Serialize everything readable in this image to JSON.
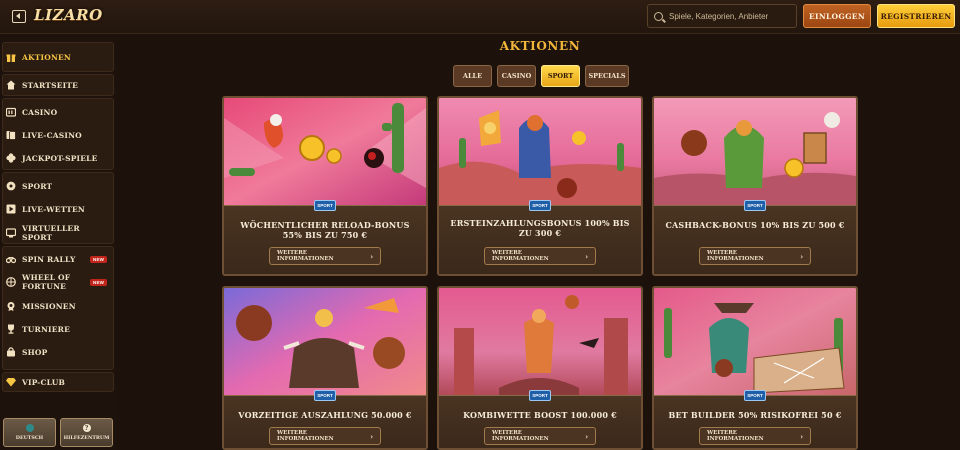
{
  "header": {
    "logo": "LIZARO",
    "search_placeholder": "Spiele, Kategorien, Anbieter",
    "login_label": "EINLOGGEN",
    "register_label": "REGISTRIEREN"
  },
  "sidebar": {
    "items": [
      {
        "label": "AKTIONEN",
        "icon": "gift-icon"
      },
      {
        "label": "STARTSEITE",
        "icon": "home-icon"
      },
      {
        "label": "CASINO",
        "icon": "slot-icon"
      },
      {
        "label": "LIVE-CASINO",
        "icon": "cards-icon"
      },
      {
        "label": "JACKPOT-SPIELE",
        "icon": "clover-icon"
      },
      {
        "label": "SPORT",
        "icon": "ball-icon"
      },
      {
        "label": "LIVE-WETTEN",
        "icon": "play-icon"
      },
      {
        "label": "VIRTUELLER SPORT",
        "icon": "virtual-icon"
      },
      {
        "label": "SPIN RALLY",
        "icon": "rally-icon",
        "badge": "NEW"
      },
      {
        "label": "WHEEL OF FORTUNE",
        "icon": "wheel-icon",
        "badge": "NEW"
      },
      {
        "label": "MISSIONEN",
        "icon": "medal-icon"
      },
      {
        "label": "TURNIERE",
        "icon": "trophy-icon"
      },
      {
        "label": "SHOP",
        "icon": "bag-icon"
      },
      {
        "label": "VIP-CLUB",
        "icon": "diamond-icon"
      }
    ],
    "language_label": "DEUTSCH",
    "help_label": "HILFEZENTRUM"
  },
  "main": {
    "title": "AKTIONEN",
    "filters": [
      "ALLE",
      "CASINO",
      "SPORT",
      "SPECIALS"
    ],
    "active_filter": "SPORT",
    "tag": "SPORT",
    "more_label": "WEITERE INFORMATIONEN",
    "cards": [
      {
        "title": "WÖCHENTLICHER RELOAD-BONUS 55% BIS ZU 750 €"
      },
      {
        "title": "ERSTEINZAHLUNGSBONUS 100% BIS ZU 300 €"
      },
      {
        "title": "CASHBACK-BONUS 10% BIS ZU 500 €"
      },
      {
        "title": "VORZEITIGE AUSZAHLUNG 50.000 €"
      },
      {
        "title": "KOMBIWETTE BOOST 100.000 €"
      },
      {
        "title": "BET BUILDER 50% RISIKOFREI 50 €"
      }
    ]
  },
  "colors": {
    "accent": "#f2b63b",
    "login": "#b15a1e",
    "register": "#f4b521",
    "sport_tag": "#1f5fa8"
  }
}
